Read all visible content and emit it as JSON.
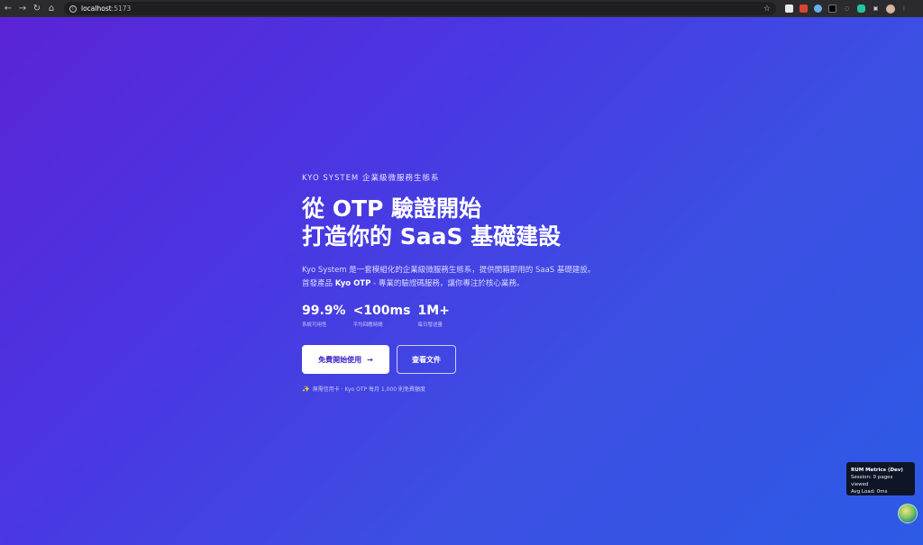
{
  "browser": {
    "url_host": "localhost",
    "url_port": ":5173",
    "back_icon": "←",
    "forward_icon": "→",
    "reload_icon": "↻",
    "home_icon": "⌂",
    "star_icon": "☆"
  },
  "hero": {
    "eyebrow": "KYO SYSTEM 企業級微服務生態系",
    "headline_line1": "從 OTP 驗證開始",
    "headline_line2": "打造你的 SaaS 基礎建設",
    "desc_line1": "Kyo System 是一套模組化的企業級微服務生態系，提供開箱即用的 SaaS 基礎建設。",
    "desc_line2_prefix": "首發產品 ",
    "desc_line2_bold": "Kyo OTP",
    "desc_line2_suffix": " - 專業的驗證碼服務，讓你專注於核心業務。",
    "stats": [
      {
        "value": "99.9%",
        "label": "系統可用性"
      },
      {
        "value": "<100ms",
        "label": "平均回應時間"
      },
      {
        "value": "1M+",
        "label": "每日發送量"
      }
    ],
    "primary_cta": "免費開始使用",
    "primary_cta_arrow": "→",
    "secondary_cta": "查看文件",
    "note_icon": "✨",
    "note": "無需信用卡 · Kyo OTP 每月 1,000 則免費額度"
  },
  "rum": {
    "title": "RUM Metrics (Dev)",
    "session": "Session: 0 pages viewed",
    "avg_load": "Avg Load: 0ms"
  },
  "colors": {
    "gradient_start": "#5a24d6",
    "gradient_end": "#2d5ae6",
    "primary_cta_text": "#3d22c9"
  }
}
